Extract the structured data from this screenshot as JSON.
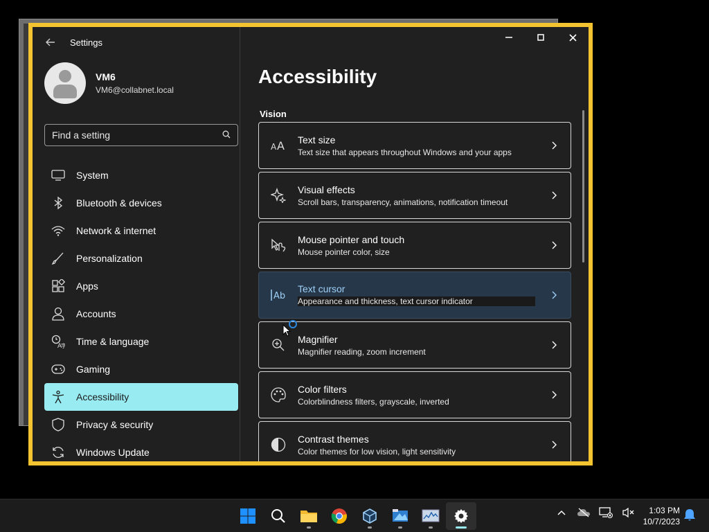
{
  "window": {
    "title": "Settings",
    "controls": {
      "minimize": "—",
      "maximize": "☐",
      "close": "✕"
    }
  },
  "profile": {
    "name": "VM6",
    "email": "VM6@collabnet.local"
  },
  "search": {
    "placeholder": "Find a setting"
  },
  "nav": {
    "items": [
      {
        "label": "System",
        "icon": "monitor-icon"
      },
      {
        "label": "Bluetooth & devices",
        "icon": "bluetooth-icon"
      },
      {
        "label": "Network & internet",
        "icon": "wifi-icon"
      },
      {
        "label": "Personalization",
        "icon": "brush-icon"
      },
      {
        "label": "Apps",
        "icon": "apps-icon"
      },
      {
        "label": "Accounts",
        "icon": "person-icon"
      },
      {
        "label": "Time & language",
        "icon": "clock-globe-icon"
      },
      {
        "label": "Gaming",
        "icon": "gamepad-icon"
      },
      {
        "label": "Accessibility",
        "icon": "accessibility-icon",
        "active": true
      },
      {
        "label": "Privacy & security",
        "icon": "shield-icon"
      },
      {
        "label": "Windows Update",
        "icon": "update-icon"
      }
    ]
  },
  "main": {
    "title": "Accessibility",
    "section": "Vision",
    "cards": [
      {
        "title": "Text size",
        "subtitle": "Text size that appears throughout Windows and your apps",
        "icon": "text-size-icon"
      },
      {
        "title": "Visual effects",
        "subtitle": "Scroll bars, transparency, animations, notification timeout",
        "icon": "sparkle-icon"
      },
      {
        "title": "Mouse pointer and touch",
        "subtitle": "Mouse pointer color, size",
        "icon": "pointer-touch-icon"
      },
      {
        "title": "Text cursor",
        "subtitle": "Appearance and thickness, text cursor indicator",
        "icon": "text-cursor-icon",
        "highlight": true
      },
      {
        "title": "Magnifier",
        "subtitle": "Magnifier reading, zoom increment",
        "icon": "magnifier-icon"
      },
      {
        "title": "Color filters",
        "subtitle": "Colorblindness filters, grayscale, inverted",
        "icon": "palette-icon"
      },
      {
        "title": "Contrast themes",
        "subtitle": "Color themes for low vision, light sensitivity",
        "icon": "contrast-icon"
      }
    ]
  },
  "taskbar": {
    "apps": [
      "windows-start-icon",
      "search-icon",
      "file-explorer-icon",
      "chrome-icon",
      "virtualbox-icon",
      "vm-manager-icon",
      "resource-monitor-icon",
      "settings-gear-icon"
    ],
    "time": "1:03 PM",
    "date": "10/7/2023"
  },
  "colors": {
    "accent": "#99ebf2",
    "window_border": "#f4c430",
    "highlight_card": "#253748"
  }
}
